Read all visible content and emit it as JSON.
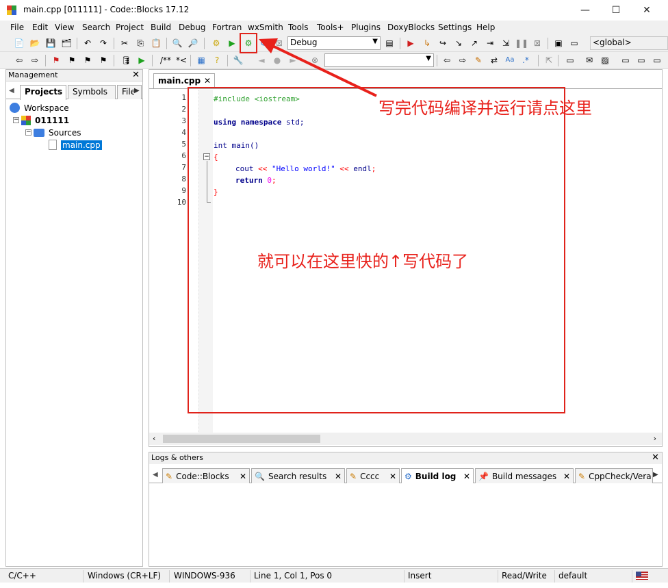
{
  "window": {
    "title": "main.cpp [011111] - Code::Blocks 17.12",
    "minimize": "—",
    "maximize": "☐",
    "close": "✕"
  },
  "menu": [
    "File",
    "Edit",
    "View",
    "Search",
    "Project",
    "Build",
    "Debug",
    "Fortran",
    "wxSmith",
    "Tools",
    "Tools+",
    "Plugins",
    "DoxyBlocks",
    "Settings",
    "Help"
  ],
  "toolbar": {
    "build_target": "Debug",
    "scope": "<global>",
    "doxy_block": "/**",
    "doxy_line": "*<",
    "regex_mark": ".*",
    "search_value": ""
  },
  "management": {
    "title": "Management",
    "tabs": [
      "Projects",
      "Symbols",
      "Files"
    ],
    "tree": {
      "workspace": "Workspace",
      "project": "011111",
      "folder": "Sources",
      "file": "main.cpp"
    }
  },
  "editor": {
    "tab": "main.cpp",
    "line_numbers": [
      "1",
      "2",
      "3",
      "4",
      "5",
      "6",
      "7",
      "8",
      "9",
      "10"
    ],
    "code": {
      "l1": "#include <iostream>",
      "l3_kw1": "using",
      "l3_kw2": "namespace",
      "l3_rest": " std;",
      "l5_kw": "int",
      "l5_rest": " main()",
      "l6": "{",
      "l7_a": "cout",
      "l7_op1": " << ",
      "l7_str": "\"Hello world!\"",
      "l7_op2": " << ",
      "l7_b": "endl",
      "l7_end": ";",
      "l8_kw": "return",
      "l8_num": "0",
      "l8_end": ";",
      "l9": "}"
    }
  },
  "logs": {
    "title": "Logs & others",
    "tabs": [
      "Code::Blocks",
      "Search results",
      "Cccc",
      "Build log",
      "Build messages",
      "CppCheck/Vera++"
    ]
  },
  "status": {
    "language": "C/C++",
    "eol": "Windows (CR+LF)",
    "encoding": "WINDOWS-936",
    "position": "Line 1, Col 1, Pos 0",
    "mode": "Insert",
    "access": "Read/Write",
    "profile": "default"
  },
  "annotations": {
    "arrow_note": "写完代码编译并运行请点这里",
    "box_note": "就可以在这里快的↑写代码了"
  },
  "colors": {
    "annotation_red": "#e0231b",
    "preprocessor": "#2ea02e",
    "keyword": "#00008b",
    "string": "#0000ff",
    "number": "#ef00ef",
    "brace": "#ff0000",
    "selection": "#0078d7"
  }
}
